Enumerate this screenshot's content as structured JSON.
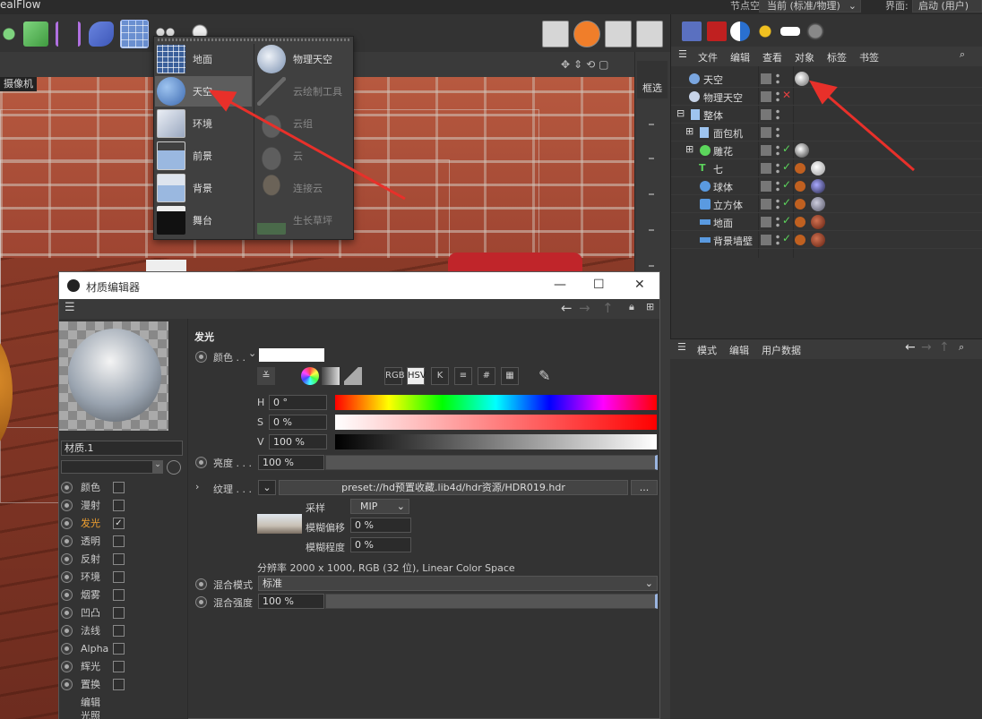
{
  "app": {
    "title": "ealFlow"
  },
  "top": {
    "nodespace_label": "节点空间:",
    "nodespace_value": "当前 (标准/物理)",
    "layout_label": "界面:",
    "layout_value": "启动 (用户)"
  },
  "viewport": {
    "camera_label": "摄像机",
    "select_tool": "框选"
  },
  "env_menu": {
    "left": [
      {
        "label": "地面",
        "icon": "floor-icon"
      },
      {
        "label": "天空",
        "icon": "sky-icon",
        "selected": true
      },
      {
        "label": "环境",
        "icon": "environment-icon"
      },
      {
        "label": "前景",
        "icon": "foreground-icon"
      },
      {
        "label": "背景",
        "icon": "background-icon"
      },
      {
        "label": "舞台",
        "icon": "stage-icon"
      }
    ],
    "right": [
      {
        "label": "物理天空",
        "icon": "physical-sky-icon",
        "disabled": false
      },
      {
        "label": "云绘制工具",
        "icon": "cloud-brush-icon",
        "disabled": true
      },
      {
        "label": "云组",
        "icon": "cloud-group-icon",
        "disabled": true
      },
      {
        "label": "云",
        "icon": "cloud-icon",
        "disabled": true
      },
      {
        "label": "连接云",
        "icon": "connect-cloud-icon",
        "disabled": true
      },
      {
        "label": "生长草坪",
        "icon": "grass-icon",
        "disabled": true
      }
    ]
  },
  "objects": {
    "menu": [
      "文件",
      "编辑",
      "查看",
      "对象",
      "标签",
      "书签"
    ],
    "items": [
      {
        "name": "天空",
        "check": "",
        "indent": 0
      },
      {
        "name": "物理天空",
        "check": "cross",
        "indent": 0
      },
      {
        "name": "整体",
        "check": "",
        "indent": 0
      },
      {
        "name": "面包机",
        "check": "",
        "indent": 1
      },
      {
        "name": "雕花",
        "check": "tick",
        "indent": 1
      },
      {
        "name": "七",
        "check": "tick",
        "indent": 1
      },
      {
        "name": "球体",
        "check": "tick",
        "indent": 1
      },
      {
        "name": "立方体",
        "check": "tick",
        "indent": 1
      },
      {
        "name": "地面",
        "check": "tick",
        "indent": 1
      },
      {
        "name": "背景墙壁",
        "check": "tick",
        "indent": 1
      }
    ]
  },
  "attributes": {
    "menu": [
      "模式",
      "编辑",
      "用户数据"
    ]
  },
  "material_editor": {
    "title": "材质编辑器",
    "material_name": "材质.1",
    "channels": [
      {
        "label": "颜色",
        "checked": false
      },
      {
        "label": "漫射",
        "checked": false
      },
      {
        "label": "发光",
        "checked": true,
        "active": true
      },
      {
        "label": "透明",
        "checked": false
      },
      {
        "label": "反射",
        "checked": false
      },
      {
        "label": "环境",
        "checked": false
      },
      {
        "label": "烟雾",
        "checked": false
      },
      {
        "label": "凹凸",
        "checked": false
      },
      {
        "label": "法线",
        "checked": false
      },
      {
        "label": "Alpha",
        "checked": false
      },
      {
        "label": "辉光",
        "checked": false
      },
      {
        "label": "置换",
        "checked": false
      },
      {
        "label": "编辑",
        "checked": null
      },
      {
        "label": "光照",
        "checked": null
      }
    ],
    "section_title": "发光",
    "color_label": "颜色 . .",
    "color_value": "#ffffff",
    "mode_buttons": [
      "RGB",
      "HSV",
      "K",
      "≡",
      "#",
      "▦"
    ],
    "h_label": "H",
    "h_value": "0 °",
    "s_label": "S",
    "s_value": "0 %",
    "v_label": "V",
    "v_value": "100 %",
    "brightness_label": "亮度 . . .",
    "brightness_value": "100 %",
    "texture_label": "纹理 . . .",
    "texture_path": "preset://hd预置收藏.lib4d/hdr资源/HDR019.hdr",
    "texture_more": "...",
    "sampling_label": "采样",
    "sampling_value": "MIP",
    "blur_offset_label": "模糊偏移",
    "blur_offset_value": "0 %",
    "blur_scale_label": "模糊程度",
    "blur_scale_value": "0 %",
    "resolution_text": "分辨率 2000 x 1000, RGB (32 位), Linear Color Space",
    "blend_mode_label": "混合模式",
    "blend_mode_value": "标准",
    "blend_strength_label": "混合强度",
    "blend_strength_value": "100 %"
  },
  "colors": {
    "accent_orange": "#f0a030",
    "arrow_red": "#e8302a",
    "check_green": "#5cd65c"
  }
}
